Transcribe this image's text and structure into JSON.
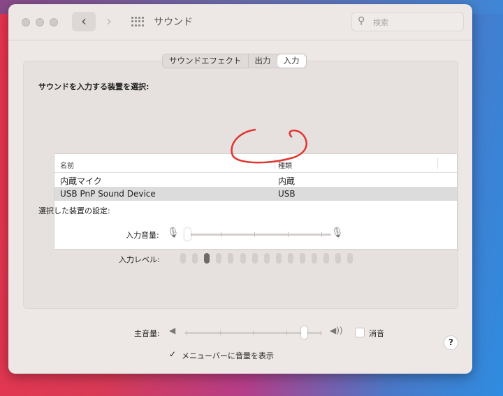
{
  "window": {
    "title": "サウンド",
    "search_placeholder": "検索"
  },
  "tabs": [
    {
      "label": "サウンドエフェクト",
      "active": false
    },
    {
      "label": "出力",
      "active": false
    },
    {
      "label": "入力",
      "active": true
    }
  ],
  "input": {
    "select_label": "サウンドを入力する装置を選択:",
    "columns": [
      "名前",
      "種類"
    ],
    "devices": [
      {
        "name": "内蔵マイク",
        "type": "内蔵",
        "selected": false
      },
      {
        "name": "USB PnP Sound Device",
        "type": "USB",
        "selected": true
      }
    ],
    "settings_label": "選択した装置の設定:",
    "volume_label": "入力音量:",
    "volume_value": 0,
    "level_label": "入力レベル:",
    "level_segments": 15,
    "level_active": 3
  },
  "output": {
    "main_volume_label": "主音量:",
    "main_volume_value": 0.88,
    "mute_label": "消音",
    "mute_checked": false,
    "show_in_menubar_label": "メニューバーに音量を表示",
    "show_in_menubar_checked": true
  },
  "help_label": "?",
  "annotation": {
    "color": "#e0352f"
  }
}
